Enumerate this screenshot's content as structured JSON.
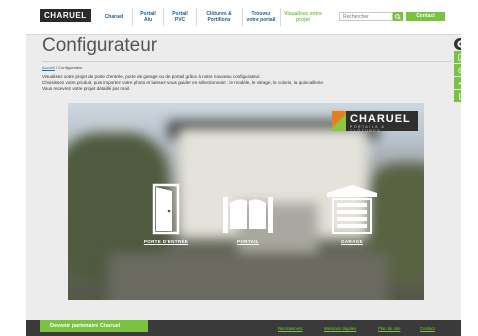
{
  "header": {
    "logo_text": "CHARUEL",
    "nav": [
      {
        "label": "Charuel"
      },
      {
        "label": "Portail Alu"
      },
      {
        "label": "Portail PVC"
      },
      {
        "label": "Clôtures & Portillons"
      },
      {
        "label": "Trouvez votre portail"
      },
      {
        "label": "Visualisez votre projet"
      }
    ],
    "search_placeholder": "Rechercher",
    "contact_label": "Contact"
  },
  "page": {
    "title": "Configurateur",
    "breadcrumb": {
      "home": "Accueil",
      "separator": " / ",
      "current": "Configurateur"
    },
    "intro": [
      "Visualisez votre projet de porte d'entrée, porte de garage ou de portail grâce à notre nouveau configurateur.",
      "Choisissez votre produit, puis importez votre photo et laissez-vous guider en sélectionnant : le modèle, le vitrage, le coloris, la quincaillerie.",
      "Vous recevrez votre projet détaillé par mail."
    ]
  },
  "hero": {
    "brand": "CHARUEL",
    "brand_tagline": "PORTAILS & CLÔTURES",
    "choices": [
      {
        "label": "PORTE D'ENTRÉE",
        "icon": "front-door-icon"
      },
      {
        "label": "PORTAIL",
        "icon": "gate-icon"
      },
      {
        "label": "GARAGE",
        "icon": "garage-door-icon"
      }
    ]
  },
  "sidebar": {
    "icons": [
      "chevron-left-icon",
      "edit-icon",
      "target-icon",
      "share-icon",
      "document-icon"
    ]
  },
  "footer": {
    "partner_label": "Devenir partenaire Charuel",
    "links": [
      "Recrutement",
      "Mentions légales",
      "Plan de site",
      "Contact"
    ]
  },
  "colors": {
    "accent_green": "#7cc242",
    "nav_blue": "#1f5b8a",
    "brand_orange": "#e67e22",
    "footer_dark": "#3a3a3a"
  }
}
